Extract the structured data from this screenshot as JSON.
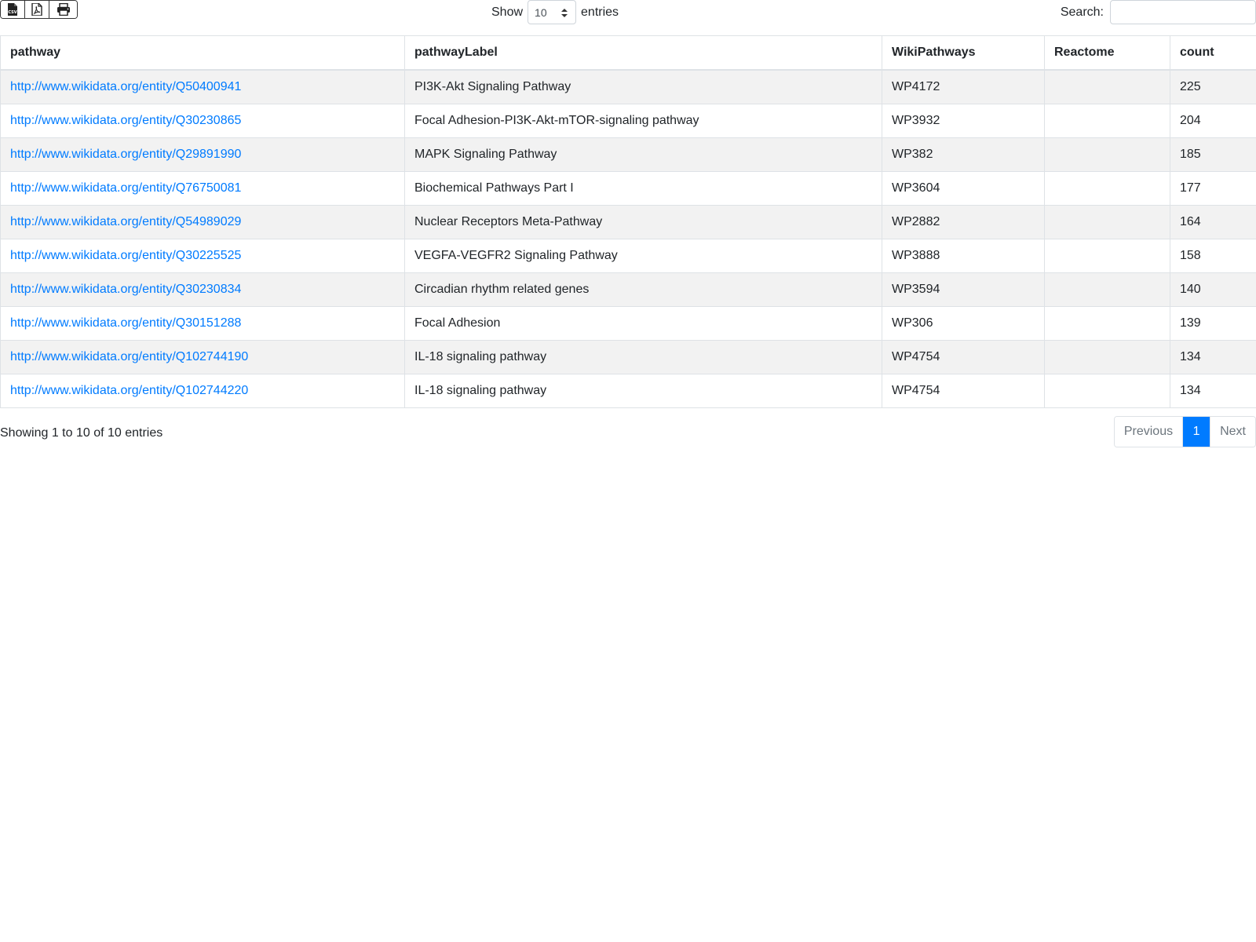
{
  "toolbar": {
    "export_buttons": [
      {
        "icon": "csv-file-icon",
        "label": "CSV"
      },
      {
        "icon": "pdf-file-icon",
        "label": ""
      },
      {
        "icon": "print-icon",
        "label": ""
      }
    ]
  },
  "length": {
    "prefix": "Show",
    "selected": "10",
    "suffix": "entries"
  },
  "search": {
    "label": "Search:",
    "value": "",
    "placeholder": ""
  },
  "table": {
    "columns": [
      "pathway",
      "pathwayLabel",
      "WikiPathways",
      "Reactome",
      "count"
    ],
    "rows": [
      {
        "pathway": "http://www.wikidata.org/entity/Q50400941",
        "pathwayLabel": "PI3K-Akt Signaling Pathway",
        "WikiPathways": "WP4172",
        "Reactome": "",
        "count": "225"
      },
      {
        "pathway": "http://www.wikidata.org/entity/Q30230865",
        "pathwayLabel": "Focal Adhesion-PI3K-Akt-mTOR-signaling pathway",
        "WikiPathways": "WP3932",
        "Reactome": "",
        "count": "204"
      },
      {
        "pathway": "http://www.wikidata.org/entity/Q29891990",
        "pathwayLabel": "MAPK Signaling Pathway",
        "WikiPathways": "WP382",
        "Reactome": "",
        "count": "185"
      },
      {
        "pathway": "http://www.wikidata.org/entity/Q76750081",
        "pathwayLabel": "Biochemical Pathways Part I",
        "WikiPathways": "WP3604",
        "Reactome": "",
        "count": "177"
      },
      {
        "pathway": "http://www.wikidata.org/entity/Q54989029",
        "pathwayLabel": "Nuclear Receptors Meta-Pathway",
        "WikiPathways": "WP2882",
        "Reactome": "",
        "count": "164"
      },
      {
        "pathway": "http://www.wikidata.org/entity/Q30225525",
        "pathwayLabel": "VEGFA-VEGFR2 Signaling Pathway",
        "WikiPathways": "WP3888",
        "Reactome": "",
        "count": "158"
      },
      {
        "pathway": "http://www.wikidata.org/entity/Q30230834",
        "pathwayLabel": "Circadian rhythm related genes",
        "WikiPathways": "WP3594",
        "Reactome": "",
        "count": "140"
      },
      {
        "pathway": "http://www.wikidata.org/entity/Q30151288",
        "pathwayLabel": "Focal Adhesion",
        "WikiPathways": "WP306",
        "Reactome": "",
        "count": "139"
      },
      {
        "pathway": "http://www.wikidata.org/entity/Q102744190",
        "pathwayLabel": "IL-18 signaling pathway",
        "WikiPathways": "WP4754",
        "Reactome": "",
        "count": "134"
      },
      {
        "pathway": "http://www.wikidata.org/entity/Q102744220",
        "pathwayLabel": "IL-18 signaling pathway",
        "WikiPathways": "WP4754",
        "Reactome": "",
        "count": "134"
      }
    ]
  },
  "footer": {
    "info": "Showing 1 to 10 of 10 entries",
    "pagination": {
      "previous": "Previous",
      "current": "1",
      "next": "Next"
    }
  },
  "colors": {
    "link": "#007bff",
    "active_page": "#007bff",
    "striped_row": "#f2f2f2",
    "border": "#dee2e6"
  }
}
